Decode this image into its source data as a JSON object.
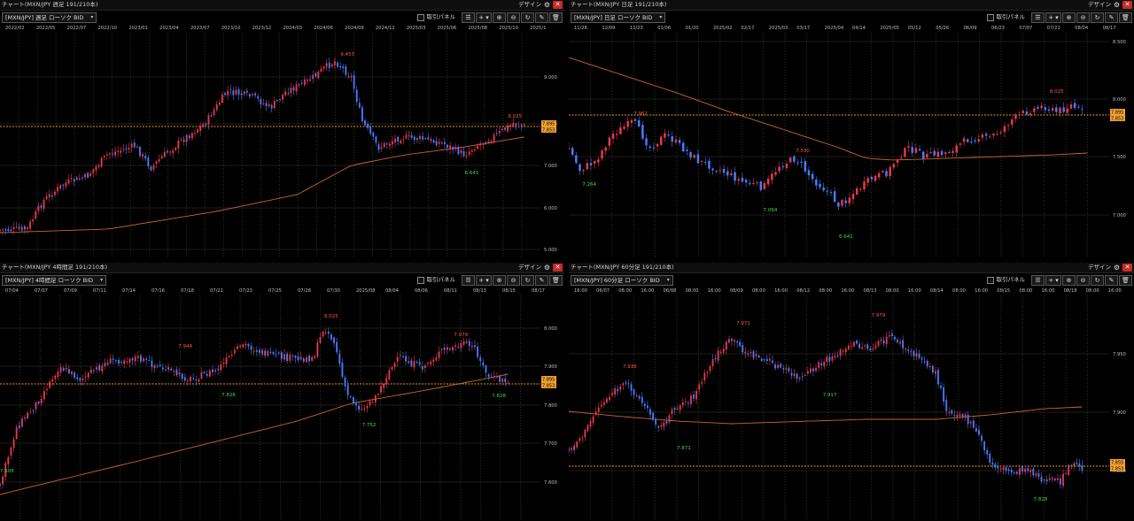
{
  "common": {
    "design_label": "デザイン",
    "close_label": "✕",
    "gear_label": "⚙",
    "trade_panel_label": "取引パネル",
    "toolbar_icons": [
      "draw-lines-icon",
      "crosshair-icon",
      "zoom-in-icon",
      "zoom-out-icon",
      "refresh-icon",
      "pencil-icon",
      "trash-icon"
    ],
    "toolbar_glyphs": [
      "☰",
      "+ ▾",
      "⊕",
      "⊖",
      "↻",
      "✎",
      "🗑"
    ],
    "colors": {
      "up": "#e8384f",
      "down": "#4a7bff",
      "ma": "#c8662c",
      "grid": "#1c1c1c",
      "vgrid": "#3f5a21",
      "price_line": "#e6962a",
      "badge": "#f0a030",
      "high_label": "#ff5a40",
      "low_label": "#3adb4a"
    }
  },
  "panels": [
    {
      "id": "weekly",
      "title": "チャート(MXN/JPY 週足 191/210本)",
      "symbol": "[MXN/JPY] 週足 ローソク BID",
      "x_ticks": [
        "2022/02",
        "2022/05",
        "2022/07",
        "2022/10",
        "2023/01",
        "2023/04",
        "2023/07",
        "2023/10",
        "2023/12",
        "2024/03",
        "2024/06",
        "2024/09",
        "2024/12",
        "2025/03",
        "2025/06",
        "2025/08",
        "2025/10",
        "2025/1"
      ],
      "y_ticks": [
        "9.000",
        "8.000",
        "7.000",
        "6.000",
        "5.000"
      ],
      "price_badges": [
        "7.895",
        "7.853"
      ],
      "high_label": "9.453",
      "recent_high_label": "8.025",
      "low_label": "6.641"
    },
    {
      "id": "daily",
      "title": "チャート(MXN/JPY 日足 191/210本)",
      "symbol": "[MXN/JPY] 日足 ローソク BID",
      "x_ticks": [
        "11/26",
        "12/09",
        "12/23",
        "01/06",
        "01/20",
        "2025/02",
        "02/17",
        "2025/03",
        "03/17",
        "2025/04",
        "04/14",
        "2025/05",
        "05/12",
        "05/26",
        "06/09",
        "06/23",
        "07/07",
        "07/21",
        "08/04",
        "08/17"
      ],
      "y_ticks": [
        "8.500",
        "8.000",
        "7.500",
        "7.000"
      ],
      "price_badges": [
        "7.895",
        "7.853"
      ],
      "labels": [
        "7.264",
        "7.962",
        "7.530",
        "7.064",
        "6.641",
        "8.025"
      ]
    },
    {
      "id": "h4",
      "title": "チャート(MXN/JPY 4時間足 191/210本)",
      "symbol": "[MXN/JPY] 4時間足 ローソク BID",
      "x_ticks": [
        "07/04",
        "07/07",
        "07/09",
        "07/11",
        "07/14",
        "07/16",
        "07/18",
        "07/21",
        "07/23",
        "07/25",
        "07/28",
        "07/30",
        "2025/08",
        "08/04",
        "08/06",
        "08/11",
        "08/13",
        "08/15",
        "08/17"
      ],
      "y_ticks": [
        "8.000",
        "7.900",
        "7.800",
        "7.700",
        "7.600"
      ],
      "price_badges": [
        "7.895",
        "7.853"
      ],
      "labels": [
        "7.944",
        "7.826",
        "8.025",
        "7.752",
        "7.979",
        "7.828",
        "7.608"
      ]
    },
    {
      "id": "h1",
      "title": "チャート(MXN/JPY 60分足 191/210本)",
      "symbol": "[MXN/JPY] 60分足 ローソク BID",
      "x_ticks": [
        "16:00",
        "06/07",
        "08:00",
        "16:00",
        "06/08",
        "08:00",
        "16:00",
        "08/09",
        "08:00",
        "16:00",
        "08/12",
        "08:00",
        "16:00",
        "08/13",
        "08:00",
        "16:00",
        "08/14",
        "08:00",
        "16:00",
        "08/15",
        "08:00",
        "16:00",
        "08/18",
        "08:00",
        "16:00"
      ],
      "y_ticks": [
        "7.950",
        "7.900",
        "7.850"
      ],
      "price_badges": [
        "7.855",
        "7.853"
      ],
      "labels": [
        "7.971",
        "7.979",
        "7.936",
        "7.917",
        "7.871",
        "7.828"
      ]
    }
  ]
}
